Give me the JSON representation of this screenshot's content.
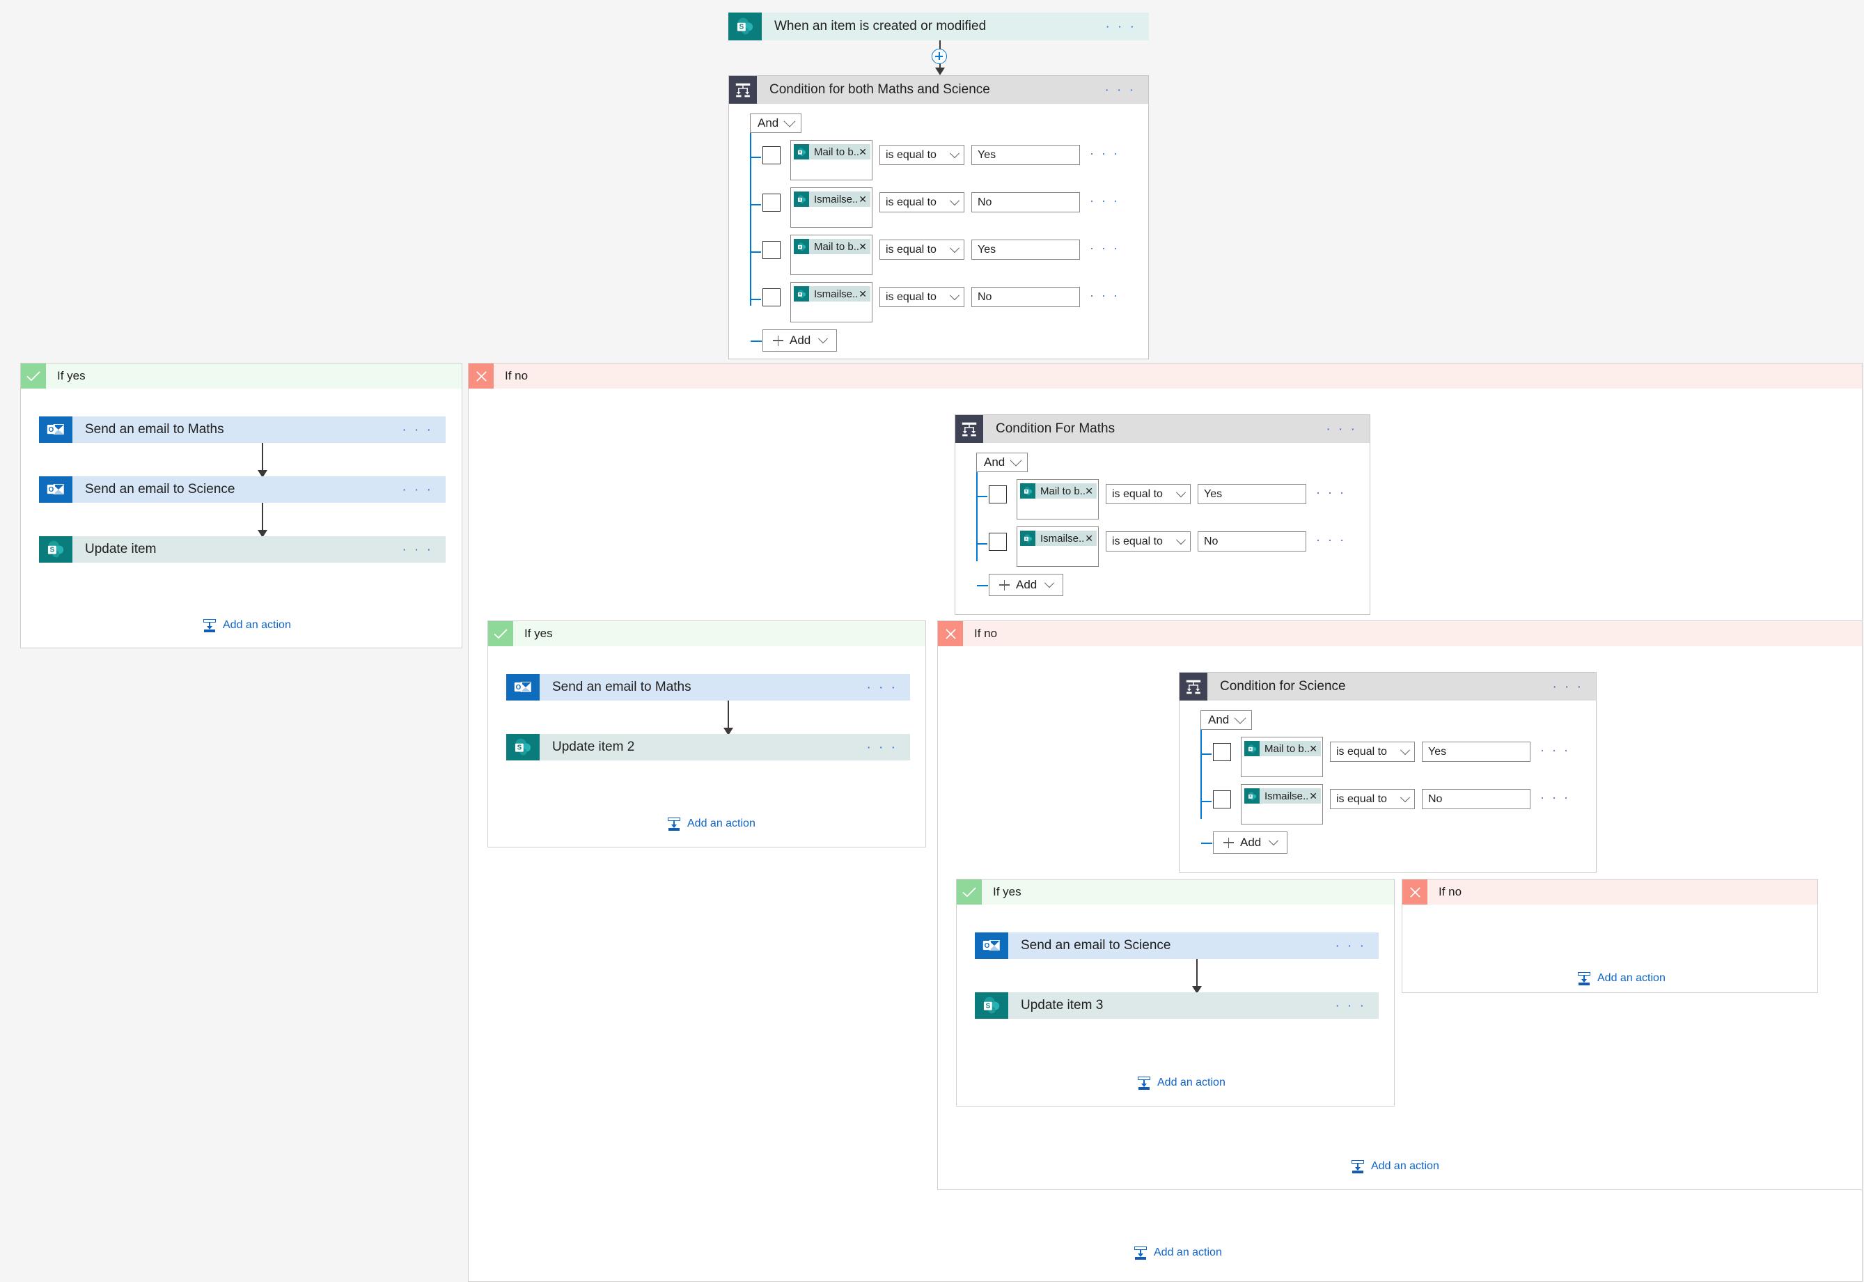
{
  "trigger": {
    "title": "When an item is created or modified",
    "icon": "sharepoint-icon",
    "menu": "· · ·"
  },
  "root_condition": {
    "title": "Condition for both Maths and Science",
    "icon": "condition-icon",
    "menu": "· · ·",
    "logic_operator": "And",
    "add_label": "Add",
    "rows": [
      {
        "token": "Mail to b...",
        "operator": "is equal to",
        "value": "Yes",
        "checked": false
      },
      {
        "token": "Ismailse...",
        "operator": "is equal to",
        "value": "No",
        "checked": false
      },
      {
        "token": "Mail to b...",
        "operator": "is equal to",
        "value": "Yes",
        "checked": false
      },
      {
        "token": "Ismailse...",
        "operator": "is equal to",
        "value": "No",
        "checked": false
      }
    ]
  },
  "maths_condition": {
    "title": "Condition For Maths",
    "icon": "condition-icon",
    "menu": "· · ·",
    "logic_operator": "And",
    "add_label": "Add",
    "rows": [
      {
        "token": "Mail to b...",
        "operator": "is equal to",
        "value": "Yes",
        "checked": false
      },
      {
        "token": "Ismailse...",
        "operator": "is equal to",
        "value": "No",
        "checked": false
      }
    ]
  },
  "science_condition": {
    "title": "Condition for Science",
    "icon": "condition-icon",
    "menu": "· · ·",
    "logic_operator": "And",
    "add_label": "Add",
    "rows": [
      {
        "token": "Mail to b...",
        "operator": "is equal to",
        "value": "Yes",
        "checked": false
      },
      {
        "token": "Ismailse...",
        "operator": "is equal to",
        "value": "No",
        "checked": false
      }
    ]
  },
  "branches": {
    "root_yes": {
      "label": "If yes",
      "add_action_label": "Add an action",
      "actions": [
        {
          "title": "Send an email to Maths",
          "type": "outlook",
          "menu": "· · ·"
        },
        {
          "title": "Send an email to Science",
          "type": "outlook",
          "menu": "· · ·"
        },
        {
          "title": "Update item",
          "type": "sharepoint",
          "menu": "· · ·"
        }
      ]
    },
    "root_no": {
      "label": "If no",
      "add_action_label": "Add an action"
    },
    "maths_yes": {
      "label": "If yes",
      "add_action_label": "Add an action",
      "actions": [
        {
          "title": "Send an email to Maths",
          "type": "outlook",
          "menu": "· · ·"
        },
        {
          "title": "Update item 2",
          "type": "sharepoint",
          "menu": "· · ·"
        }
      ]
    },
    "maths_no": {
      "label": "If no",
      "add_action_label": "Add an action"
    },
    "science_yes": {
      "label": "If yes",
      "add_action_label": "Add an action",
      "actions": [
        {
          "title": "Send an email to Science",
          "type": "outlook",
          "menu": "· · ·"
        },
        {
          "title": "Update item 3",
          "type": "sharepoint",
          "menu": "· · ·"
        }
      ]
    },
    "science_no": {
      "label": "If no",
      "add_action_label": "Add an action"
    }
  },
  "colors": {
    "sharepoint": "#0a7c7c",
    "outlook": "#0f6cbd",
    "condition": "#3f4254",
    "yes_badge": "#8ed99a",
    "no_badge": "#f98f80",
    "link": "#0f64c8",
    "rail": "#0078d4"
  }
}
